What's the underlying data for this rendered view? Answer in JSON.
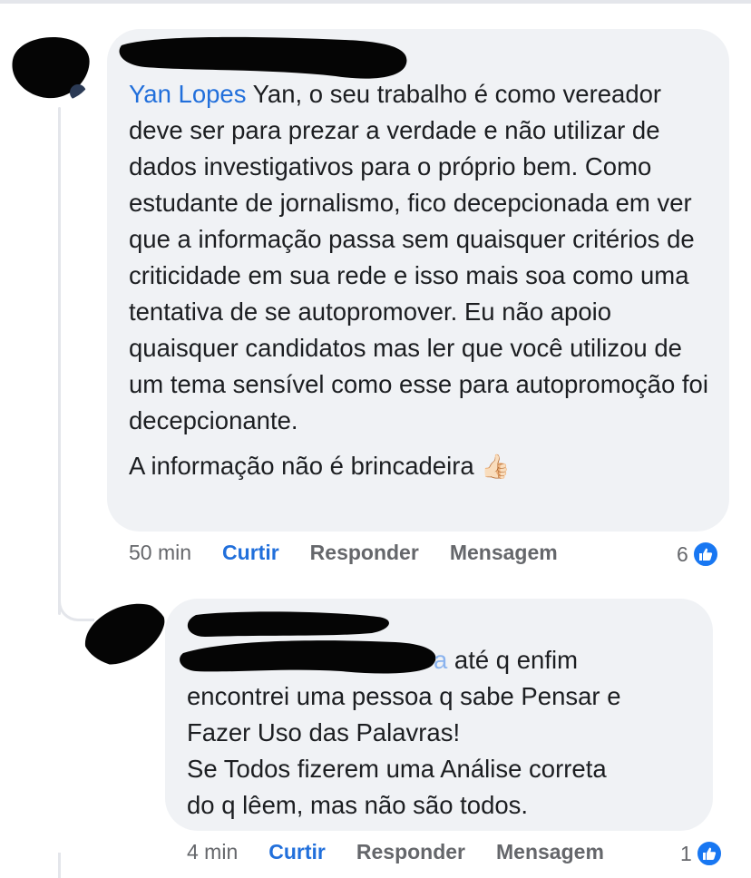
{
  "thread": {
    "main_comment": {
      "mention": "Yan Lopes",
      "body": " Yan, o seu trabalho é como vereador deve ser para prezar a verdade e não utilizar de dados investigativos para o próprio bem. Como estudante de jornalismo, fico decepcionada em ver que a informação passa sem quaisquer critérios de criticidade em sua rede e isso mais soa como uma tentativa de se autopromover. Eu não apoio quaisquer candidatos mas ler que você utilizou de um tema sensível como esse para autopromoção foi decepcionante.",
      "closing": "A informação não é brincadeira ",
      "closing_emoji": "👍🏻",
      "time": "50 min",
      "like_label": "Curtir",
      "reply_label": "Responder",
      "message_label": "Mensagem",
      "reaction_count": "6"
    },
    "reply_comment": {
      "mention_tail": "a",
      "body": " até q enfim\nencontrei uma pessoa q sabe Pensar e\nFazer Uso das Palavras!\nSe Todos fizerem uma Análise correta\ndo q lêem, mas não são todos.",
      "time": "4 min",
      "like_label": "Curtir",
      "reply_label": "Responder",
      "message_label": "Mensagem",
      "reaction_count": "1"
    }
  },
  "colors": {
    "bubble": "#f0f2f5",
    "link": "#216fdb",
    "muted": "#65676b",
    "like_badge": "#1877f2"
  },
  "icons": {
    "reaction": "like-thumb-icon"
  }
}
